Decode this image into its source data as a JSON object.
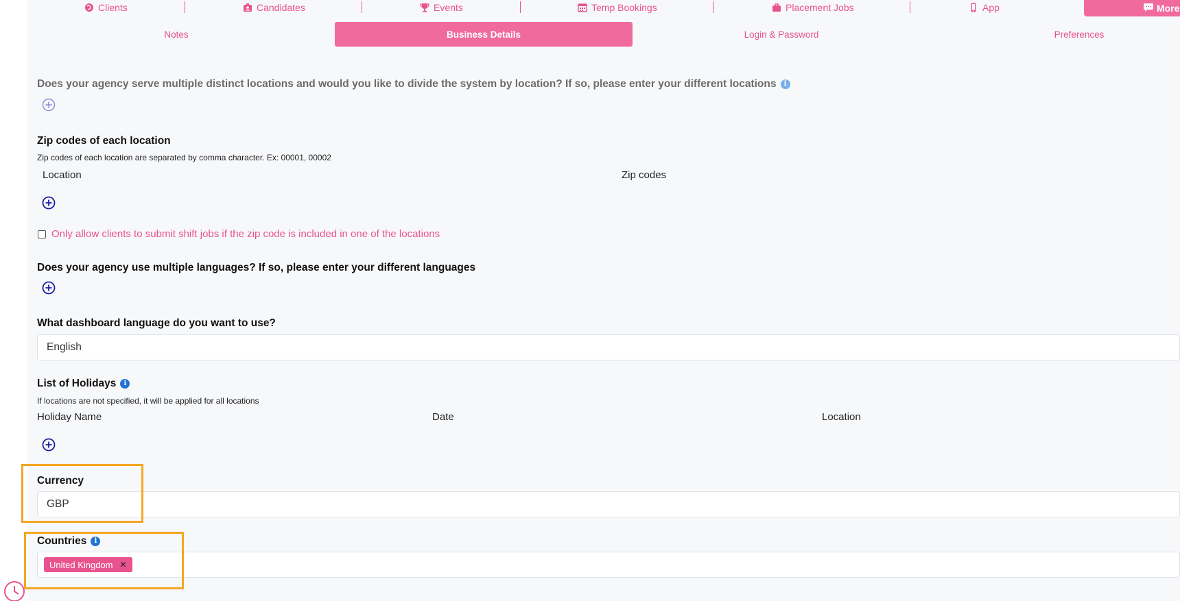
{
  "nav": {
    "items": [
      {
        "label": "Clients",
        "icon": "globe-icon"
      },
      {
        "label": "Candidates",
        "icon": "id-badge-icon"
      },
      {
        "label": "Events",
        "icon": "trophy-icon"
      },
      {
        "label": "Temp Bookings",
        "icon": "calendar-icon"
      },
      {
        "label": "Placement Jobs",
        "icon": "briefcase-icon"
      },
      {
        "label": "App",
        "icon": "mobile-icon"
      }
    ],
    "more_label": "More"
  },
  "subtabs": [
    {
      "label": "Notes",
      "active": false
    },
    {
      "label": "Business Details",
      "active": true
    },
    {
      "label": "Login & Password",
      "active": false
    },
    {
      "label": "Preferences",
      "active": false
    }
  ],
  "locations": {
    "question": "Does your agency serve multiple distinct locations and would you like to divide the system by location? If so, please enter your different locations"
  },
  "zip": {
    "title": "Zip codes of each location",
    "hint": "Zip codes of each location are separated by comma character. Ex: 00001, 00002",
    "col_location": "Location",
    "col_zip": "Zip codes",
    "checkbox_label": "Only allow clients to submit shift jobs if the zip code is included in one of the locations"
  },
  "languages": {
    "question": "Does your agency use multiple languages? If so, please enter your different languages"
  },
  "dashboard_language": {
    "question": "What dashboard language do you want to use?",
    "value": "English"
  },
  "holidays": {
    "title": "List of Holidays",
    "hint": "If locations are not specified, it will be applied for all locations",
    "col_name": "Holiday Name",
    "col_date": "Date",
    "col_location": "Location"
  },
  "currency": {
    "label": "Currency",
    "value": "GBP"
  },
  "countries": {
    "label": "Countries",
    "tags": [
      "United Kingdom"
    ]
  },
  "colors": {
    "accent": "#e8538f",
    "accent_fill": "#f06a9e",
    "plus_icon": "#1a1aa8",
    "highlight": "#f5a623",
    "info": "#1f73d4"
  }
}
